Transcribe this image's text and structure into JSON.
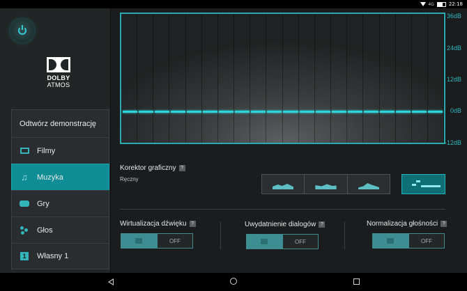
{
  "status_bar": {
    "network": "4G",
    "time": "22:18"
  },
  "sidebar": {
    "brand_line1": "DOLBY",
    "brand_line2": "ATMOS",
    "demo_label": "Odtwórz demonstrację",
    "items": [
      {
        "label": "Filmy",
        "icon": "film-icon",
        "active": false
      },
      {
        "label": "Muzyka",
        "icon": "music-note-icon",
        "active": true
      },
      {
        "label": "Gry",
        "icon": "gamepad-icon",
        "active": false
      },
      {
        "label": "Głos",
        "icon": "voice-icon",
        "active": false
      },
      {
        "label": "Własny 1",
        "icon": "custom-1-icon",
        "active": false
      }
    ],
    "custom_badge": "1"
  },
  "graph": {
    "db_labels": [
      "36dB",
      "24dB",
      "12dB",
      "0dB",
      "-12dB"
    ],
    "eq_level_db": 0,
    "band_count": 20
  },
  "equalizer": {
    "title": "Korektor graficzny",
    "help": "?",
    "mode": "Ręczny",
    "presets": [
      "open-preset",
      "rich-preset",
      "focused-preset"
    ],
    "selected_preset": "manual"
  },
  "features": [
    {
      "label": "Wirtualizacja dźwięku",
      "help": "?",
      "state_label": "OFF"
    },
    {
      "label": "Uwydatnienie dialogów",
      "help": "?",
      "state_label": "OFF"
    },
    {
      "label": "Normalizacja głośności",
      "help": "?",
      "state_label": "OFF"
    }
  ],
  "colors": {
    "accent": "#0f8d94",
    "line": "#2fd3da"
  }
}
